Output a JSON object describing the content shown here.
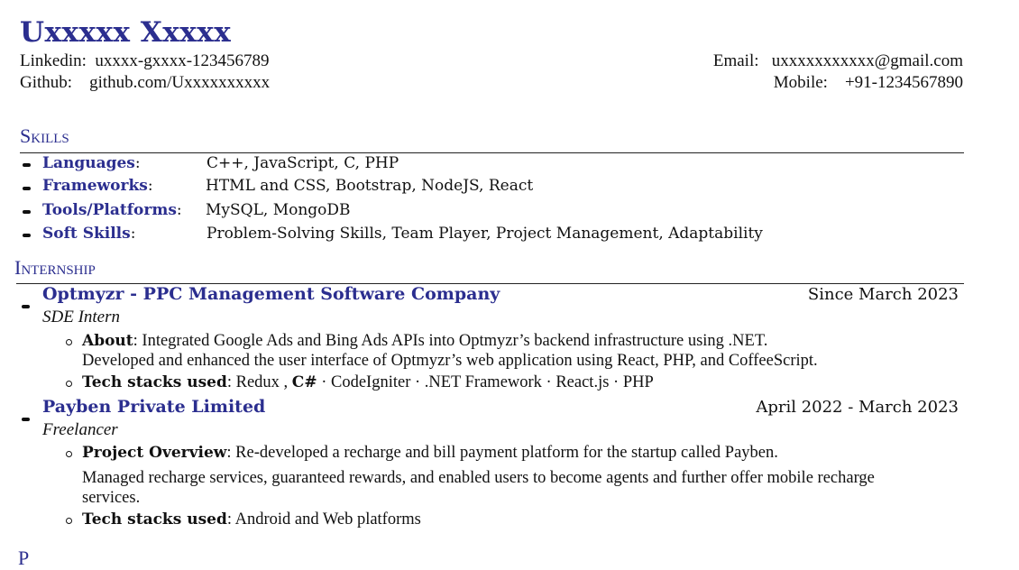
{
  "header": {
    "name": "Uxxxxx  Xxxxx",
    "linkedin_label": "Linkedin:",
    "linkedin_value": "uxxxx-gxxxx-123456789",
    "github_label": "Github:",
    "github_value": "github.com/Uxxxxxxxxxx",
    "email_label": "Email:",
    "email_value": "uxxxxxxxxxxx@gmail.com",
    "mobile_label": "Mobile:",
    "mobile_value": "+91-1234567890"
  },
  "skills": {
    "heading": "Skills",
    "items": [
      {
        "name": "Languages",
        "value": "C++, JavaScript, C, PHP"
      },
      {
        "name": "Frameworks",
        "value": "HTML and CSS, Bootstrap, NodeJS, React"
      },
      {
        "name": "Tools/Platforms",
        "value": "MySQL, MongoDB"
      },
      {
        "name": "Soft Skills",
        "value": "Problem-Solving Skills, Team Player, Project Management, Adaptability"
      }
    ]
  },
  "internship": {
    "heading": "Internship",
    "entries": [
      {
        "org": "Optmyzr - PPC Management Software Company",
        "date": "Since March 2023",
        "role": "SDE Intern",
        "about_label": "About",
        "about_text": ": Integrated Google Ads and Bing Ads APIs into Optmyzr’s backend infrastructure using  .NET.",
        "about_text_2": "Developed and enhanced the user interface of Optmyzr’s web application using React, PHP, and CoffeeScript.",
        "tech_label": "Tech stacks used",
        "tech_text_a": ": Redux , ",
        "tech_text_b": "C#",
        "tech_text_c": " · CodeIgniter · .NET Framework · React.js · PHP"
      },
      {
        "org": "Payben Private Limited",
        "date": "April 2022 - March 2023",
        "role": "Freelancer",
        "overview_label": "Project Overview",
        "overview_text": ":  Re-developed a recharge and bill payment platform for the startup called Payben.",
        "overview_text_2": "Managed recharge services, guaranteed rewards, and enabled users to become agents and further offer mobile recharge",
        "overview_text_3": "services.",
        "tech_label": "Tech stacks used",
        "tech_text": ": Android and Web platforms"
      }
    ]
  },
  "next_section": {
    "heading_partial": "P"
  }
}
